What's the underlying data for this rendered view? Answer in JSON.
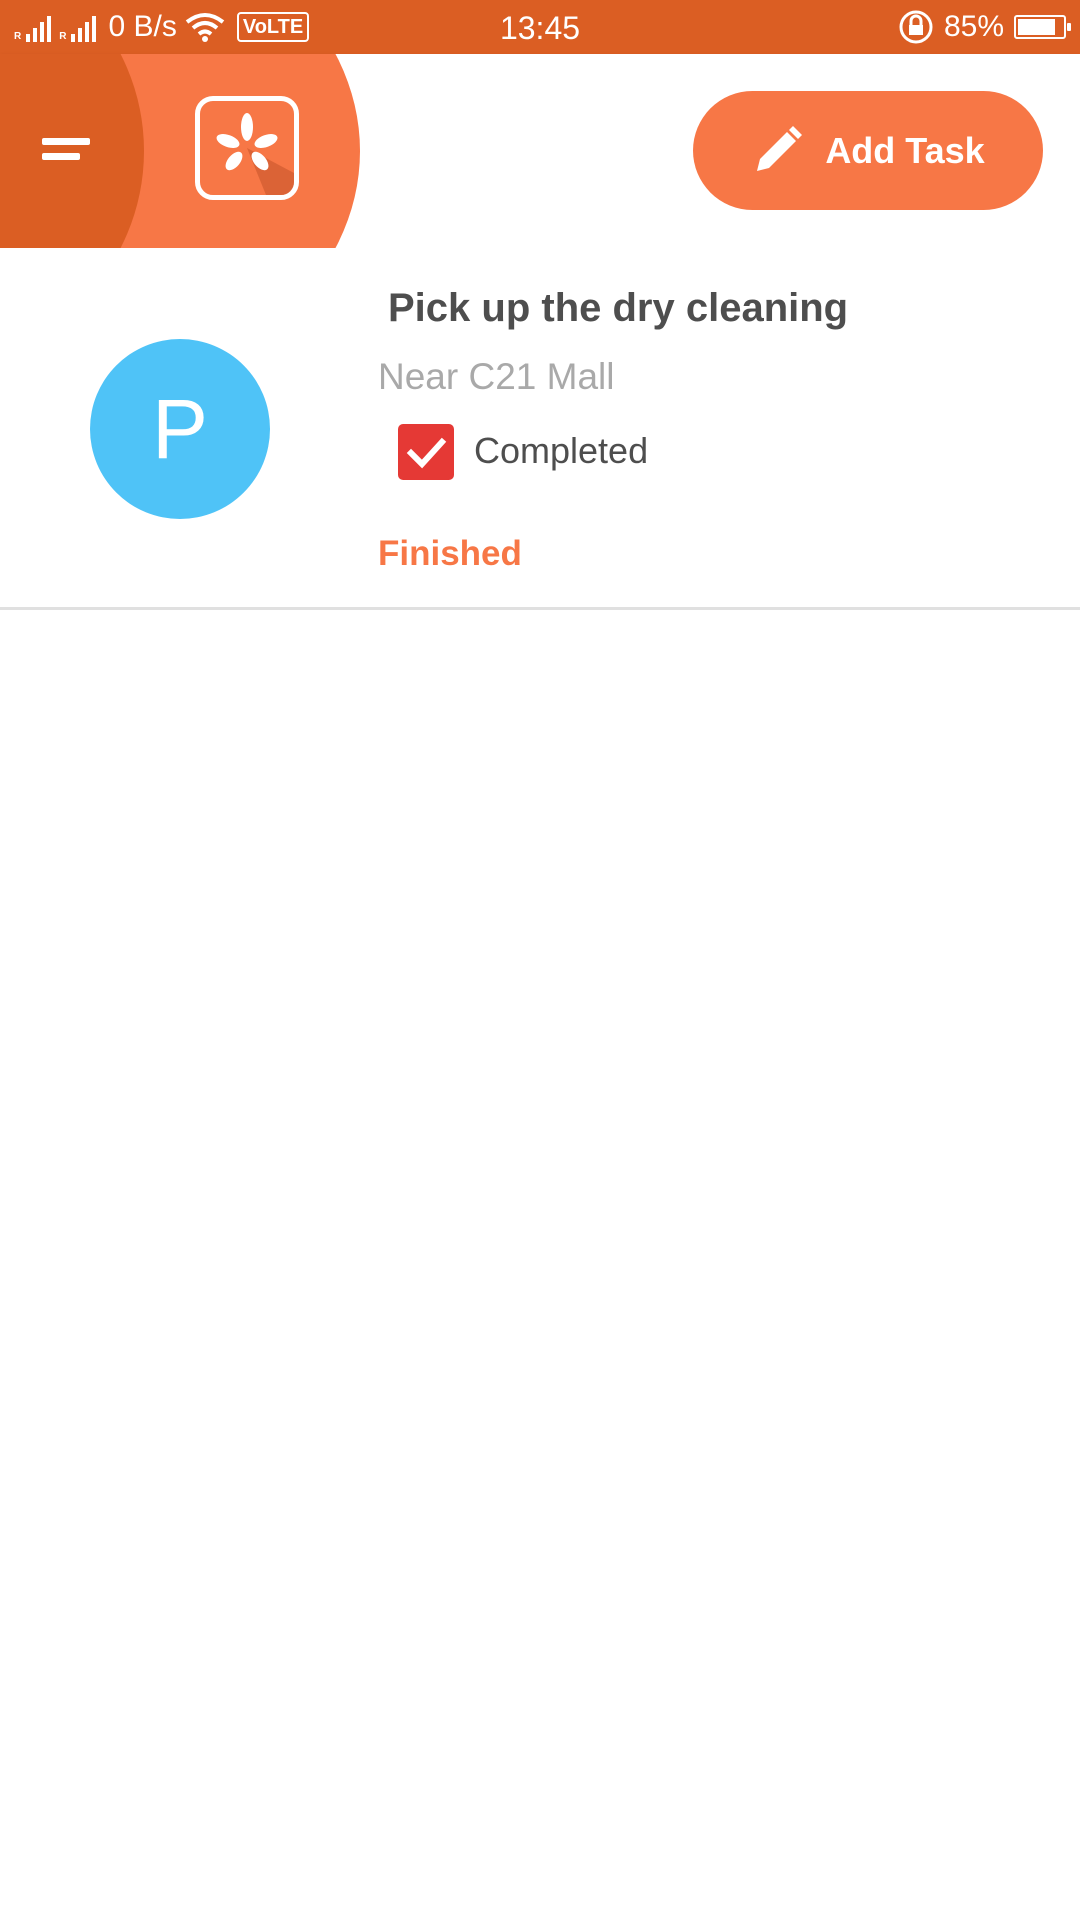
{
  "status_bar": {
    "net_speed": "0 B/s",
    "volte": "VoLTE",
    "time": "13:45",
    "battery_percent": "85%",
    "battery_level": 0.85
  },
  "app_bar": {
    "menu_icon": "menu-icon",
    "logo_icon": "yelp-logo-icon",
    "add_task_label": "Add Task",
    "add_task_icon": "pencil-icon",
    "accent_color": "#f77746",
    "dark_color": "#db5e23"
  },
  "tasks": [
    {
      "avatar_letter": "P",
      "avatar_color": "#4fc3f7",
      "title": "Pick up the dry cleaning",
      "location": "Near C21 Mall",
      "completed_label": "Completed",
      "completed": true,
      "status": "Finished"
    }
  ]
}
